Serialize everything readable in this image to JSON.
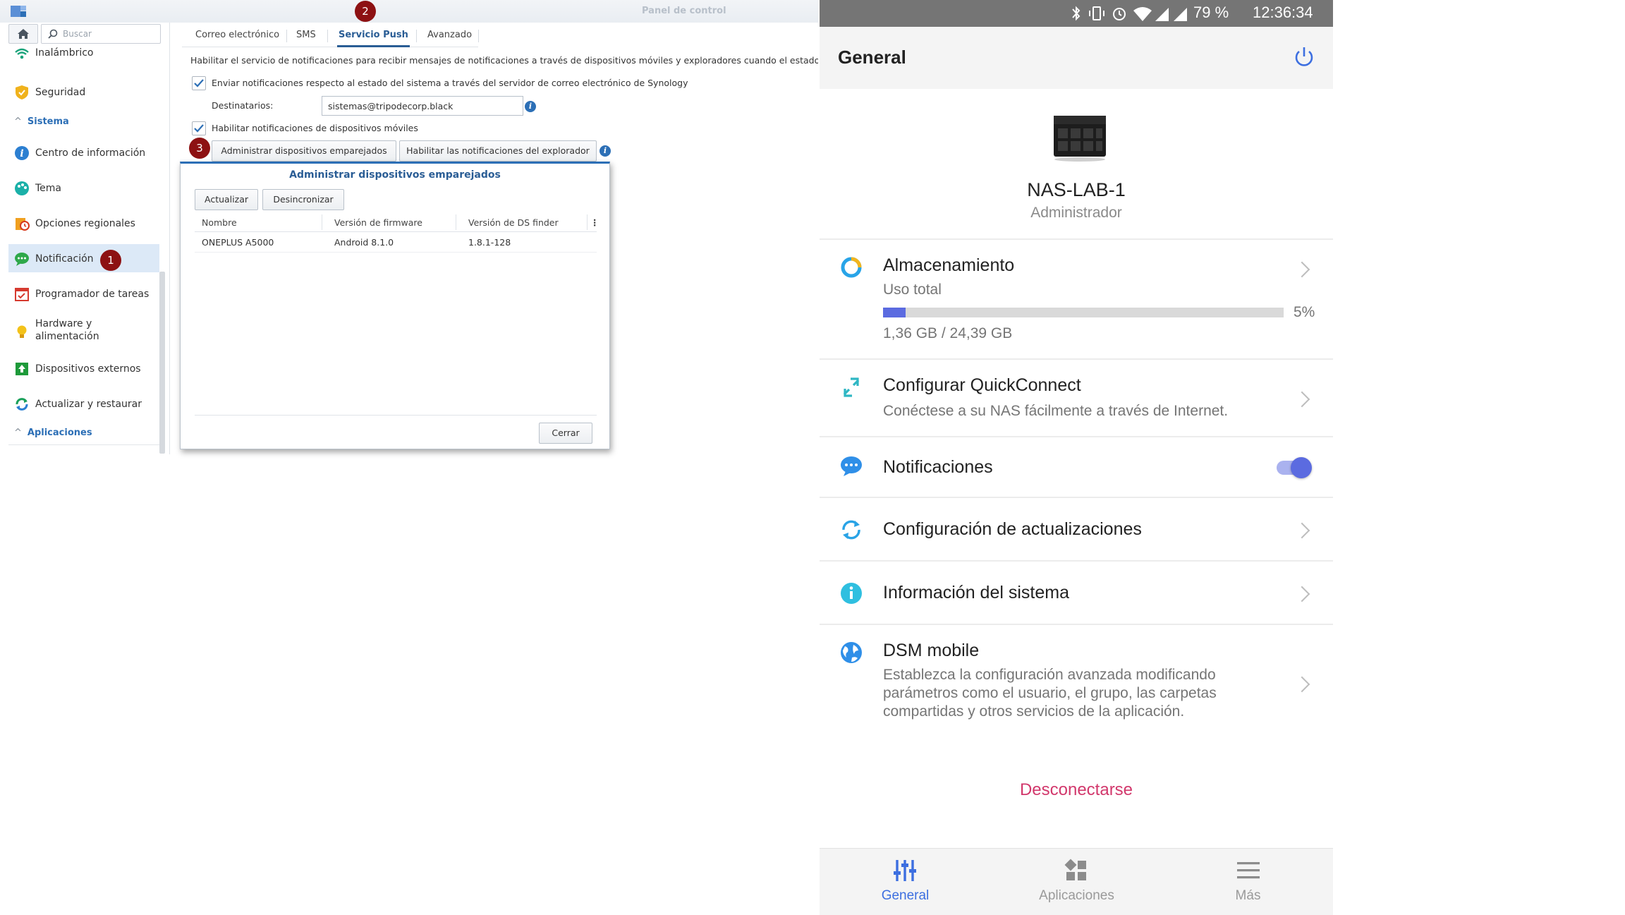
{
  "dsm": {
    "window_title": "Panel de control",
    "search_placeholder": "Buscar",
    "sidebar": {
      "items": [
        {
          "label": "Inalámbrico"
        },
        {
          "label": "Seguridad"
        },
        {
          "label": "Centro de información"
        },
        {
          "label": "Tema"
        },
        {
          "label": "Opciones regionales"
        },
        {
          "label": "Notificación"
        },
        {
          "label": "Programador de tareas"
        },
        {
          "label": "Hardware y alimentación"
        },
        {
          "label": "Dispositivos externos"
        },
        {
          "label": "Actualizar y restaurar"
        }
      ],
      "section_system": "Sistema",
      "section_apps": "Aplicaciones"
    },
    "badges": {
      "one": "1",
      "two": "2",
      "three": "3"
    },
    "tabs": [
      {
        "label": "Correo electrónico"
      },
      {
        "label": "SMS"
      },
      {
        "label": "Servicio Push"
      },
      {
        "label": "Avanzado"
      }
    ],
    "description": "Habilitar el servicio de notificaciones para recibir mensajes de notificaciones a través de dispositivos móviles y exploradores cuando el estado cam",
    "email_check_label": "Enviar notificaciones respecto al estado del sistema a través del servidor de correo electrónico de Synology",
    "recipients_label": "Destinatarios:",
    "recipients_value": "sistemas@tripodecorp.black",
    "mobile_check_label": "Habilitar notificaciones de dispositivos móviles",
    "manage_button": "Administrar dispositivos emparejados",
    "browser_button": "Habilitar las notificaciones del explorador",
    "modal": {
      "title": "Administrar dispositivos emparejados",
      "refresh_button": "Actualizar",
      "unsync_button": "Desincronizar",
      "columns": [
        "Nombre",
        "Versión de firmware",
        "Versión de DS finder"
      ],
      "rows": [
        {
          "name": "ONEPLUS A5000",
          "firmware": "Android 8.1.0",
          "finder": "1.8.1-128"
        }
      ],
      "close_button": "Cerrar"
    }
  },
  "phone": {
    "status": {
      "battery": "79 %",
      "time": "12:36:34"
    },
    "appbar_title": "General",
    "device": {
      "name": "NAS-LAB-1",
      "role": "Administrador"
    },
    "storage": {
      "title": "Almacenamiento",
      "subtitle": "Uso total",
      "percent_label": "5%",
      "used_fraction": 0.056,
      "usage": "1,36 GB / 24,39 GB"
    },
    "quickconnect": {
      "title": "Configurar QuickConnect",
      "subtitle": "Conéctese a su NAS fácilmente a través de Internet."
    },
    "notifications": {
      "title": "Notificaciones",
      "enabled": true
    },
    "updates": {
      "title": "Configuración de actualizaciones"
    },
    "sysinfo": {
      "title": "Información del sistema"
    },
    "dsm_mobile": {
      "title": "DSM mobile",
      "subtitle": "Establezca la configuración avanzada modificando parámetros como el usuario, el grupo, las carpetas compartidas y otros servicios de la aplicación."
    },
    "logout": "Desconectarse",
    "nav": [
      {
        "label": "General"
      },
      {
        "label": "Aplicaciones"
      },
      {
        "label": "Más"
      }
    ],
    "colors": {
      "accent": "#5b6be0",
      "logout": "#d2386c",
      "toggle": "#5b6be0"
    }
  }
}
